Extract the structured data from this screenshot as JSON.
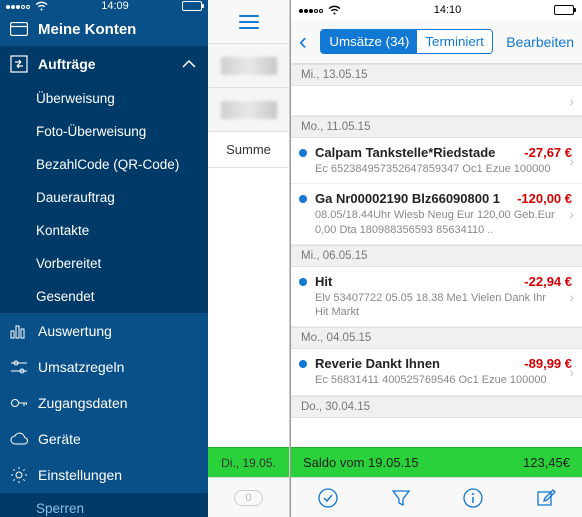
{
  "status": {
    "time_left": "14:09",
    "time_right": "14:10"
  },
  "sidebar": {
    "title": "Meine Konten",
    "section": "Aufträge",
    "subs": [
      "Überweisung",
      "Foto-Überweisung",
      "BezahlCode (QR-Code)",
      "Dauerauftrag",
      "Kontakte",
      "Vorbereitet",
      "Gesendet"
    ],
    "items": [
      "Auswertung",
      "Umsatzregeln",
      "Zugangsdaten",
      "Geräte",
      "Einstellungen"
    ],
    "bottom": "Sperren"
  },
  "mid": {
    "sum_label": "Summe",
    "date": "Di., 19.05.",
    "count": "0"
  },
  "nav": {
    "seg_active": "Umsätze (34)",
    "seg_other": "Terminiert",
    "edit": "Bearbeiten"
  },
  "list": [
    {
      "type": "header",
      "label": "Mi., 13.05.15"
    },
    {
      "type": "empty"
    },
    {
      "type": "header",
      "label": "Mo., 11.05.15"
    },
    {
      "type": "tx",
      "dot": true,
      "name": "Calpam Tankstelle*Riedstade",
      "amount": "-27,67 €",
      "desc": "Ec 652384957352647859347 Oc1 Ezue 100000"
    },
    {
      "type": "tx",
      "dot": true,
      "name": "Ga Nr00002190 Blz66090800 1",
      "amount": "-120,00 €",
      "desc": "08.05/18.44Uhr Wiesb Neug Eur 120,00 Geb.Eur 0,00 Dta 180988356593 85634110 .."
    },
    {
      "type": "header",
      "label": "Mi., 06.05.15"
    },
    {
      "type": "tx",
      "dot": true,
      "name": "Hit",
      "amount": "-22,94 €",
      "desc": "Elv 53407722 05.05 18.38 Me1 Vielen Dank Ihr Hit Markt"
    },
    {
      "type": "header",
      "label": "Mo., 04.05.15"
    },
    {
      "type": "tx",
      "dot": true,
      "name": "Reverie Dankt Ihnen",
      "amount": "-89,99 €",
      "desc": "Ec 56831411 400525769546 Oc1 Ezue 100000"
    },
    {
      "type": "header",
      "label": "Do., 30.04.15"
    }
  ],
  "saldo": {
    "label": "Saldo vom 19.05.15",
    "amount": "123,45€"
  }
}
